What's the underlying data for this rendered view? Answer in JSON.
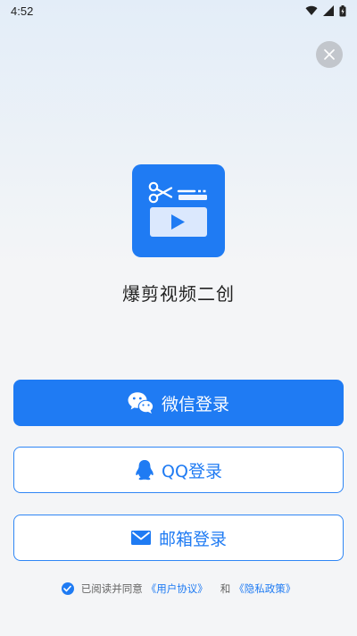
{
  "status_bar": {
    "time": "4:52",
    "icons": [
      "wifi-icon",
      "signal-icon",
      "battery-icon"
    ]
  },
  "close": {
    "icon": "close-icon"
  },
  "app": {
    "name": "爆剪视频二创",
    "logo": "scissors-video-logo"
  },
  "buttons": {
    "wechat": {
      "label": "微信登录",
      "icon": "wechat-icon"
    },
    "qq": {
      "label": "QQ登录",
      "icon": "qq-penguin-icon"
    },
    "mail": {
      "label": "邮箱登录",
      "icon": "mail-icon"
    }
  },
  "agreement": {
    "checked": true,
    "prefix": "已阅读并同意",
    "user_agreement": "《用户协议》",
    "conjunction": "和",
    "privacy_policy": "《隐私政策》"
  },
  "colors": {
    "accent": "#1f7bf3",
    "close_bg": "#c2c6cc",
    "text": "#222222"
  }
}
